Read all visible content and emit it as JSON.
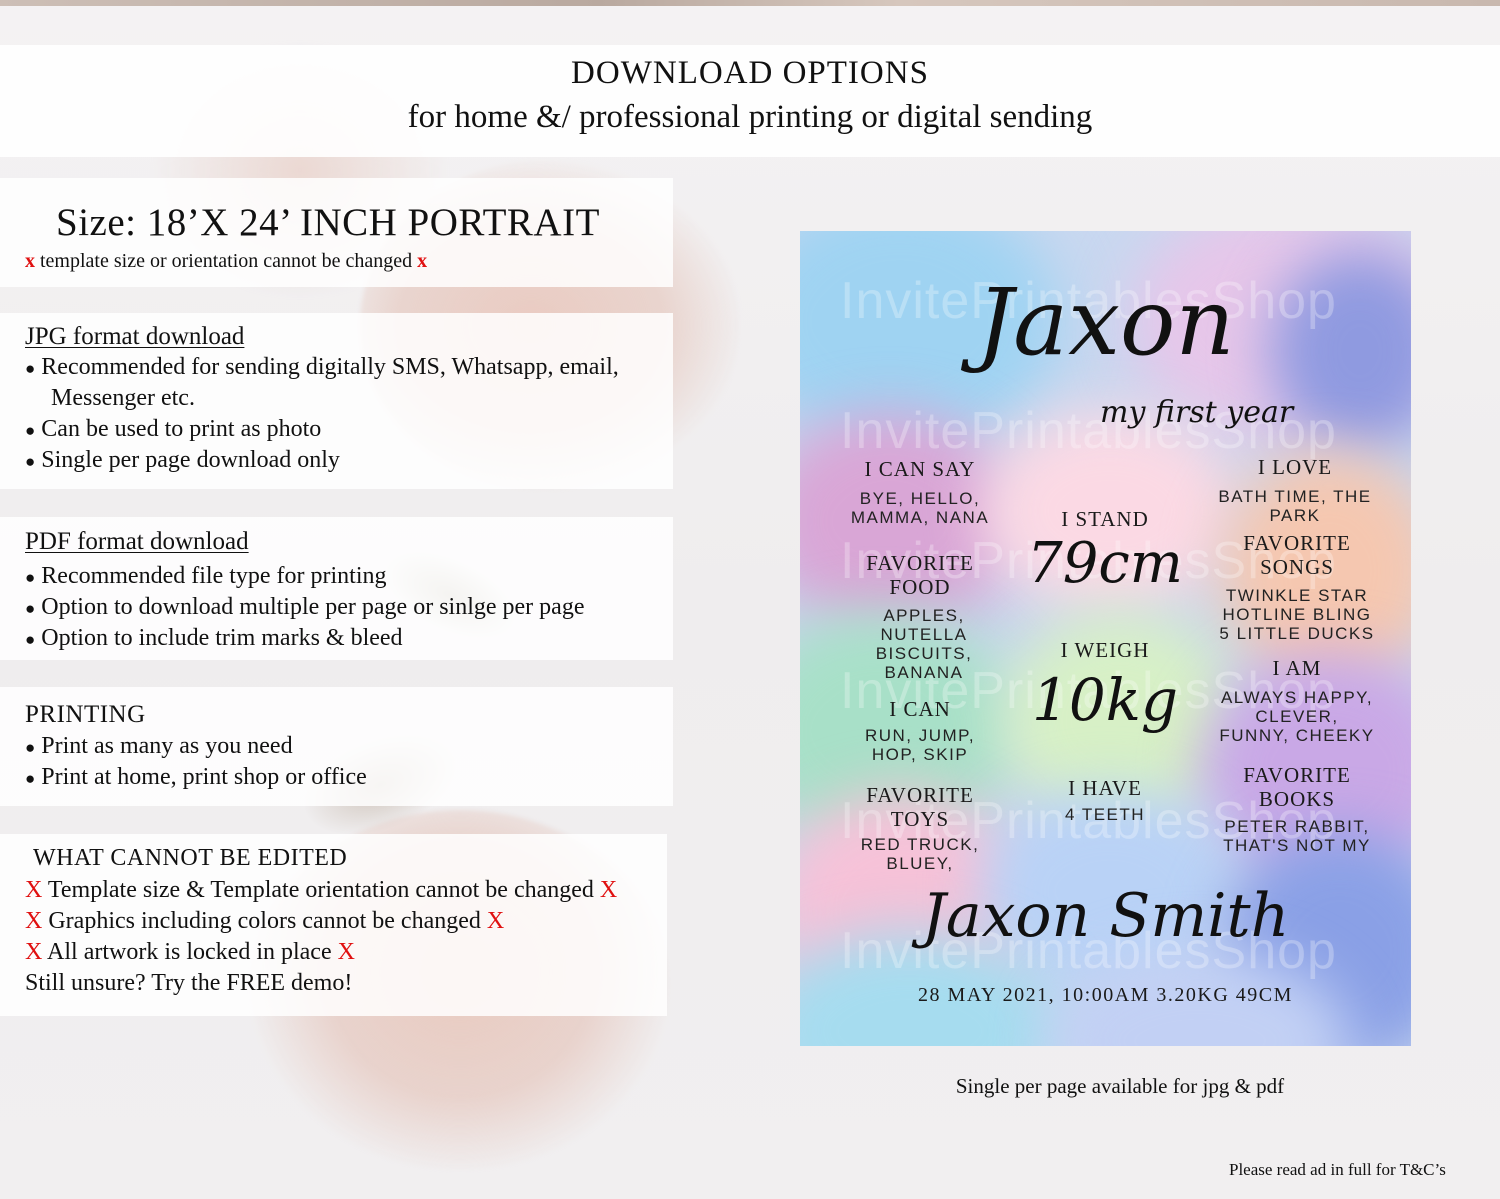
{
  "header": {
    "title": "DOWNLOAD OPTIONS",
    "subtitle": "for home &/ professional printing or digital sending"
  },
  "size_panel": {
    "title": "Size: 18’X 24’ INCH PORTRAIT",
    "mark": "x",
    "note": "template size or orientation cannot be changed"
  },
  "jpg_panel": {
    "title": "JPG format download",
    "bullet": "●",
    "items": [
      "Recommended for sending digitally SMS, Whatsapp, email,",
      "Messenger etc.",
      "Can be used to print as photo",
      "Single per page download only"
    ]
  },
  "pdf_panel": {
    "title": "PDF format download",
    "items": [
      "Recommended file type for printing",
      "Option to download multiple per page or sinlge per page",
      "Option to include trim marks & bleed"
    ]
  },
  "printing_panel": {
    "title": "PRINTING",
    "items": [
      "Print as many as you need",
      "Print at home, print shop or office"
    ]
  },
  "edit_panel": {
    "title": "WHAT CANNOT BE EDITED",
    "mark": "X",
    "items": [
      "Template size & Template orientation cannot be changed",
      "Graphics including colors cannot be changed",
      "All artwork is locked in place"
    ],
    "closing": "Still unsure? Try the FREE demo!"
  },
  "poster": {
    "watermark": "InvitePrintablesShop",
    "name": "Jaxon",
    "subtitle": "my first year",
    "left": [
      {
        "heading": "I CAN SAY",
        "value": [
          "BYE, HELLO,",
          "MAMMA, NANA"
        ]
      },
      {
        "heading": [
          "FAVORITE",
          "FOOD"
        ],
        "value": [
          "APPLES,",
          "NUTELLA",
          "BISCUITS,",
          "BANANA"
        ]
      },
      {
        "heading": "I CAN",
        "value": [
          "RUN, JUMP,",
          "HOP, SKIP"
        ]
      },
      {
        "heading": [
          "FAVORITE",
          "TOYS"
        ],
        "value": [
          "RED TRUCK,",
          "BLUEY,"
        ]
      }
    ],
    "center": {
      "stand_label": "I STAND",
      "stand_value": "79cm",
      "weigh_label": "I WEIGH",
      "weigh_value": "10kg",
      "have_label": "I HAVE",
      "have_value": "4 TEETH"
    },
    "right": [
      {
        "heading": "I LOVE",
        "value": [
          "BATH TIME, THE",
          "PARK"
        ]
      },
      {
        "heading": [
          "FAVORITE",
          "SONGS"
        ],
        "value": [
          "TWINKLE STAR",
          "HOTLINE BLING",
          "5 LITTLE DUCKS"
        ]
      },
      {
        "heading": "I AM",
        "value": [
          "ALWAYS HAPPY,",
          "CLEVER,",
          "FUNNY, CHEEKY"
        ]
      },
      {
        "heading": [
          "FAVORITE",
          "BOOKS"
        ],
        "value": [
          "PETER RABBIT,",
          "THAT'S NOT MY"
        ]
      }
    ],
    "full_name": "Jaxon Smith",
    "birth_details": "28 MAY 2021, 10:00AM 3.20KG 49CM"
  },
  "caption": "Single per page available for jpg & pdf",
  "footer": "Please read ad in full for T&C’s"
}
